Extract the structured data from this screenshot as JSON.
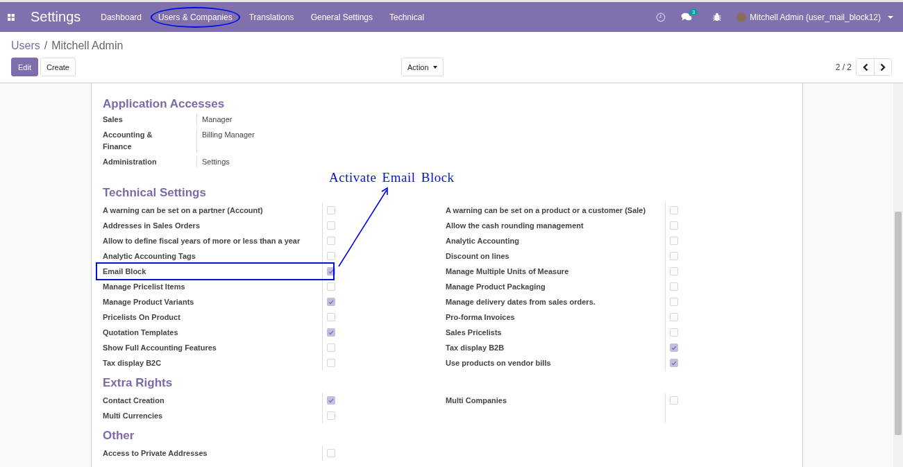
{
  "navbar": {
    "app_title": "Settings",
    "menu": [
      {
        "label": "Dashboard",
        "circled": false
      },
      {
        "label": "Users & Companies",
        "circled": true
      },
      {
        "label": "Translations",
        "circled": false
      },
      {
        "label": "General Settings",
        "circled": false
      },
      {
        "label": "Technical",
        "circled": false
      }
    ],
    "chat_badge": "3",
    "user": "Mitchell Admin (user_mail_block12)"
  },
  "breadcrumb": {
    "parent": "Users",
    "separator": "/",
    "current": "Mitchell Admin"
  },
  "buttons": {
    "edit": "Edit",
    "create": "Create",
    "action": "Action"
  },
  "pager": "2 / 2",
  "sections": [
    {
      "title": "Application Accesses",
      "kind": "selection",
      "fields": [
        {
          "label": "Sales",
          "value": "Manager"
        },
        {
          "label": "Accounting & Finance",
          "value": "Billing Manager"
        },
        {
          "label": "Administration",
          "value": "Settings"
        }
      ]
    },
    {
      "title": "Technical Settings",
      "kind": "checkboxes",
      "columns": [
        [
          {
            "label": "A warning can be set on a partner (Account)",
            "checked": false,
            "boxed": false
          },
          {
            "label": "Addresses in Sales Orders",
            "checked": false,
            "boxed": false
          },
          {
            "label": "Allow to define fiscal years of more or less than a year",
            "checked": false,
            "boxed": false
          },
          {
            "label": "Analytic Accounting Tags",
            "checked": false,
            "boxed": false
          },
          {
            "label": "Email Block",
            "checked": true,
            "boxed": true
          },
          {
            "label": "Manage Pricelist Items",
            "checked": false,
            "boxed": false
          },
          {
            "label": "Manage Product Variants",
            "checked": true,
            "boxed": false
          },
          {
            "label": "Pricelists On Product",
            "checked": false,
            "boxed": false
          },
          {
            "label": "Quotation Templates",
            "checked": true,
            "boxed": false
          },
          {
            "label": "Show Full Accounting Features",
            "checked": false,
            "boxed": false
          },
          {
            "label": "Tax display B2C",
            "checked": false,
            "boxed": false
          }
        ],
        [
          {
            "label": "A warning can be set on a product or a customer (Sale)",
            "checked": false,
            "boxed": false
          },
          {
            "label": "Allow the cash rounding management",
            "checked": false,
            "boxed": false
          },
          {
            "label": "Analytic Accounting",
            "checked": false,
            "boxed": false
          },
          {
            "label": "Discount on lines",
            "checked": false,
            "boxed": false
          },
          {
            "label": "Manage Multiple Units of Measure",
            "checked": false,
            "boxed": false
          },
          {
            "label": "Manage Product Packaging",
            "checked": false,
            "boxed": false
          },
          {
            "label": "Manage delivery dates from sales orders.",
            "checked": false,
            "boxed": false
          },
          {
            "label": "Pro-forma Invoices",
            "checked": false,
            "boxed": false
          },
          {
            "label": "Sales Pricelists",
            "checked": false,
            "boxed": false
          },
          {
            "label": "Tax display B2B",
            "checked": true,
            "boxed": false
          },
          {
            "label": "Use products on vendor bills",
            "checked": true,
            "boxed": false
          }
        ]
      ]
    },
    {
      "title": "Extra Rights",
      "kind": "checkboxes",
      "columns": [
        [
          {
            "label": "Contact Creation",
            "checked": true,
            "boxed": false
          },
          {
            "label": "Multi Currencies",
            "checked": false,
            "boxed": false
          }
        ],
        [
          {
            "label": "Multi Companies",
            "checked": false,
            "boxed": false
          }
        ]
      ]
    },
    {
      "title": "Other",
      "kind": "checkboxes",
      "columns": [
        [
          {
            "label": "Access to Private Addresses",
            "checked": false,
            "boxed": false
          }
        ]
      ]
    }
  ],
  "annotation": {
    "text": "Activate Email Block"
  }
}
